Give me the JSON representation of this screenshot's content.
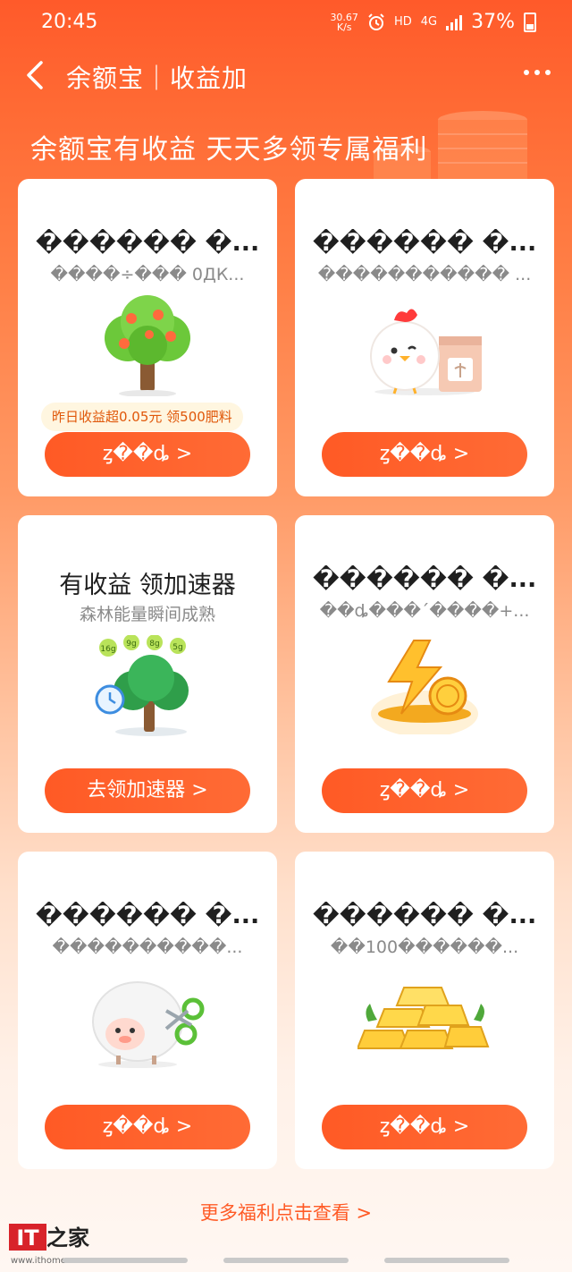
{
  "status_bar": {
    "time": "20:45",
    "net_speed_value": "30.67",
    "net_speed_unit": "K/s",
    "hd_label": "HD",
    "network_label": "4G",
    "battery_percent": "37%"
  },
  "nav": {
    "title": "余额宝｜收益加"
  },
  "hero": {
    "title": "余额宝有收益 天天多领专属福利"
  },
  "cards": [
    {
      "title": "������ �...",
      "subtitle": "����÷��� 0ДК...",
      "tip": "昨日收益超0.05元 领500肥料",
      "button": "ȥ��ȡ >",
      "icon": "fruit-tree-icon"
    },
    {
      "title": "������ �...",
      "subtitle": "����������� ...",
      "button": "ȥ��ȡ >",
      "icon": "chick-icon"
    },
    {
      "title": "有收益 领加速器",
      "subtitle": "森林能量瞬间成熟",
      "button": "去领加速器 >",
      "icon": "speed-tree-icon"
    },
    {
      "title": "������ �...",
      "subtitle": "��ȡ���´����+...",
      "button": "ȥ��ȡ >",
      "icon": "lightning-coin-icon"
    },
    {
      "title": "������ �...",
      "subtitle": "����������...",
      "button": "ȥ��ȡ >",
      "icon": "sheep-icon"
    },
    {
      "title": "������ �...",
      "subtitle": "��100������...",
      "button": "ȥ��ȡ >",
      "icon": "gold-bars-icon"
    }
  ],
  "more_link": "更多福利点击查看 >",
  "watermark": {
    "logo_text": "IT之家",
    "url": "www.ithome.com"
  },
  "colors": {
    "brand_orange": "#ff5a25",
    "tip_text": "#e0580a",
    "tip_bg": "#fff6e0"
  }
}
